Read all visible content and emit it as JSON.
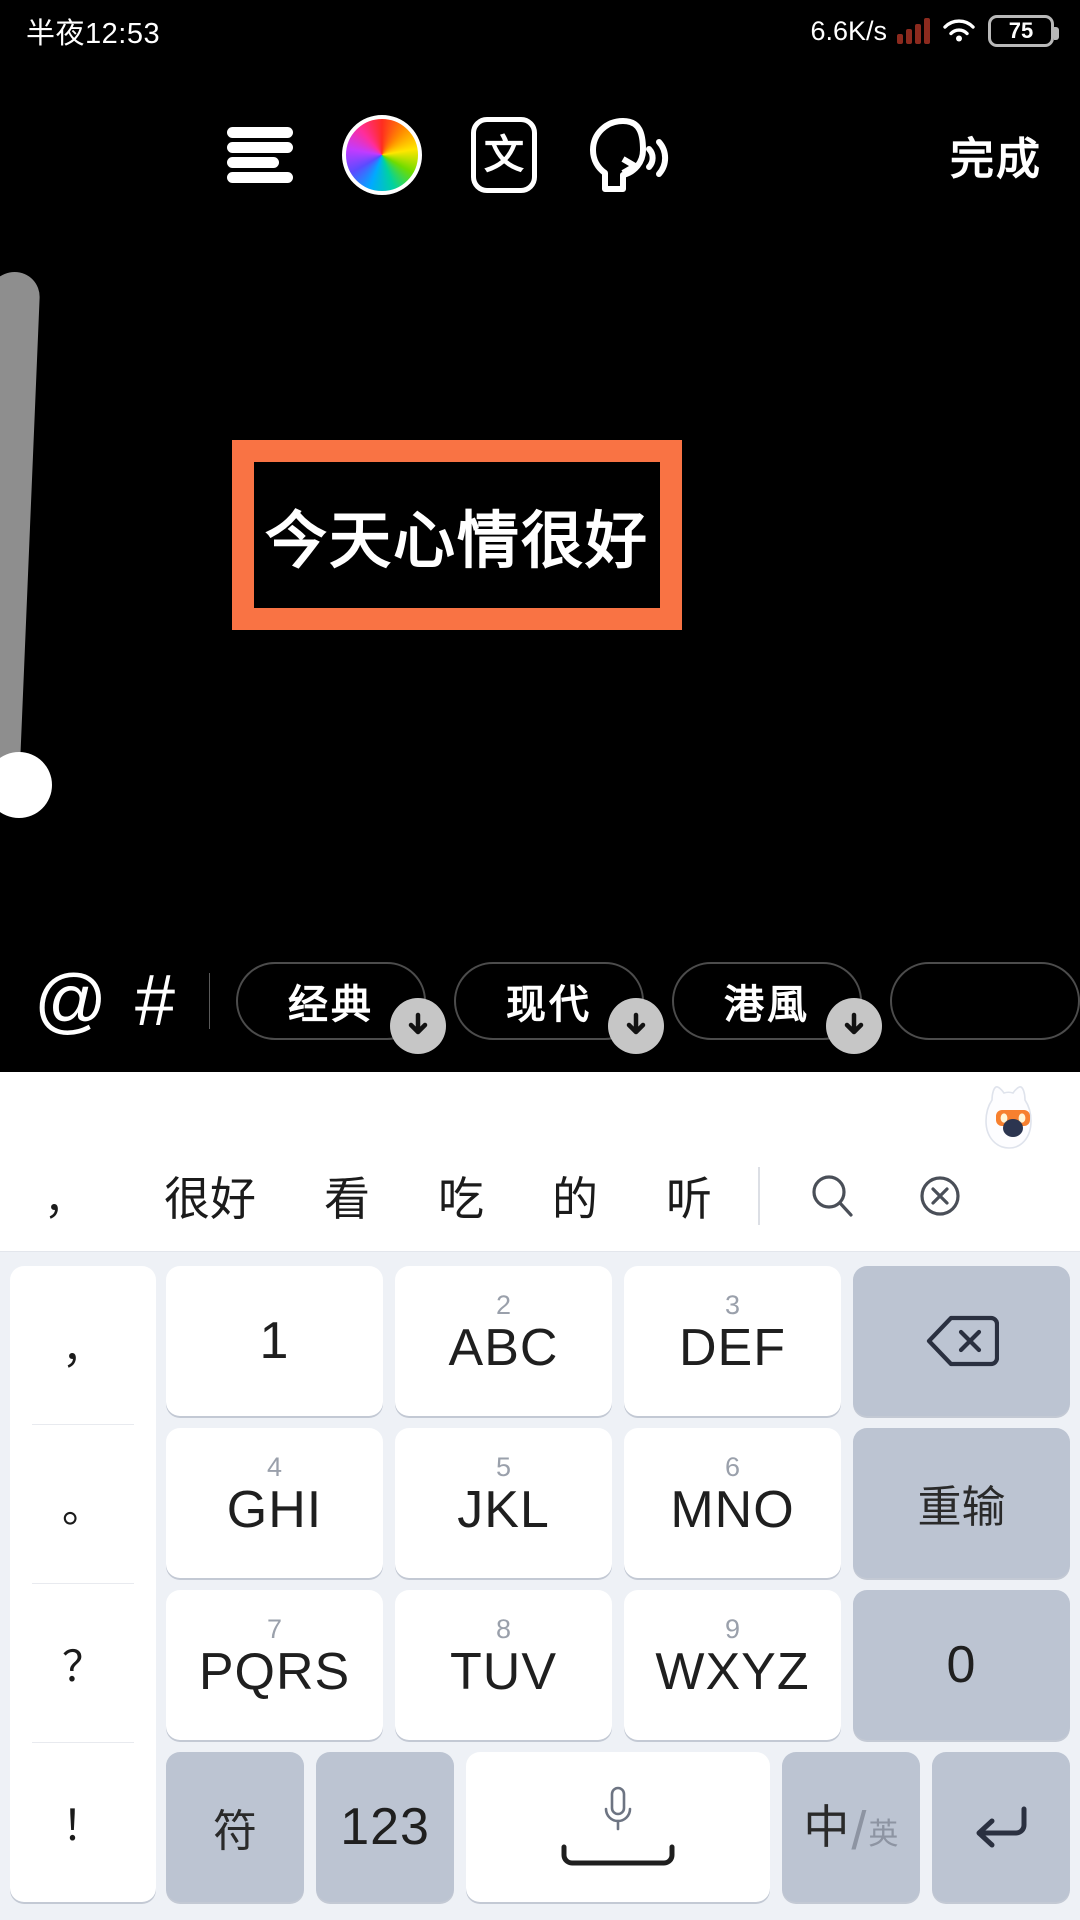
{
  "status_bar": {
    "time": "半夜12:53",
    "net_speed": "6.6K/s",
    "battery_level": "75",
    "icons": [
      "signal-bars-icon",
      "wifi-icon",
      "battery-icon"
    ]
  },
  "editor": {
    "toolbar": {
      "align_icon": "text-align-icon",
      "color_icon": "color-wheel-icon",
      "language_icon_label": "文",
      "tts_icon": "text-to-speech-icon",
      "done_label": "完成"
    },
    "text_card": {
      "content": "今天心情很好",
      "border_color": "#f97344",
      "background_color": "#000000",
      "text_color": "#ffffff"
    },
    "size_slider": {
      "name": "font-size-slider",
      "track_color": "#8e8e8e",
      "thumb_color": "#ffffff"
    },
    "bottom_bar": {
      "at_label": "@",
      "hash_label": "#",
      "chips": [
        {
          "label": "经典",
          "download": true
        },
        {
          "label": "现代",
          "download": true
        },
        {
          "label": "港風",
          "download": true
        },
        {
          "label": "",
          "download": false
        }
      ]
    }
  },
  "keyboard": {
    "mascot": "sogou-fox-mascot-icon",
    "suggestions": [
      "，",
      "很好",
      "看",
      "吃",
      "的",
      "听"
    ],
    "suggestion_actions": [
      {
        "name": "search-icon",
        "glyph": "search"
      },
      {
        "name": "close-circle-icon",
        "glyph": "close"
      }
    ],
    "punctuation_column": [
      "，",
      "。",
      "？",
      "！"
    ],
    "rows": [
      [
        {
          "num": "",
          "main": "1",
          "type": "normal"
        },
        {
          "num": "2",
          "main": "ABC",
          "type": "normal"
        },
        {
          "num": "3",
          "main": "DEF",
          "type": "normal"
        },
        {
          "num": "",
          "main": "",
          "type": "fn",
          "icon": "backspace-icon"
        }
      ],
      [
        {
          "num": "4",
          "main": "GHI",
          "type": "normal"
        },
        {
          "num": "5",
          "main": "JKL",
          "type": "normal"
        },
        {
          "num": "6",
          "main": "MNO",
          "type": "normal"
        },
        {
          "num": "",
          "main": "重输",
          "type": "fn"
        }
      ],
      [
        {
          "num": "7",
          "main": "PQRS",
          "type": "normal"
        },
        {
          "num": "8",
          "main": "TUV",
          "type": "normal"
        },
        {
          "num": "9",
          "main": "WXYZ",
          "type": "normal"
        },
        {
          "num": "",
          "main": "0",
          "type": "fn"
        }
      ]
    ],
    "bottom_row": {
      "symbols_label": "符",
      "numbers_label": "123",
      "space_icon": "microphone-icon",
      "lang_zh": "中",
      "lang_en": "英",
      "enter_icon": "enter-icon"
    }
  },
  "colors": {
    "accent_orange": "#f97344",
    "keyboard_bg": "#eef1f6",
    "key_bg": "#ffffff",
    "fn_key_bg": "#bcc4d2"
  }
}
